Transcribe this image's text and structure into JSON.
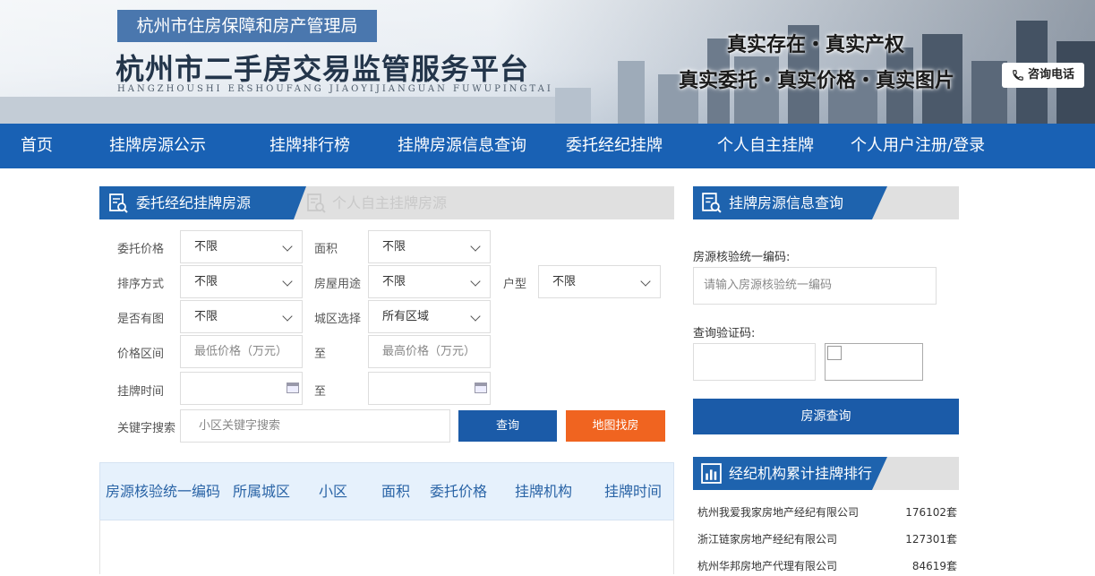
{
  "header": {
    "agency": "杭州市住房保障和房产管理局",
    "title": "杭州市二手房交易监管服务平台",
    "title_pinyin": "HANGZHOUSHI  ERSHOUFANG  JIAOYIJIANGUAN  FUWUPINGTAI",
    "slogan_line1": "真实存在・真实产权",
    "slogan_line2": "真实委托・真实价格・真实图片",
    "consult_label": "咨询电话"
  },
  "nav": [
    "首页",
    "挂牌房源公示",
    "挂牌排行榜",
    "挂牌房源信息查询",
    "委托经纪挂牌",
    "个人自主挂牌",
    "个人用户注册/登录"
  ],
  "tabs": {
    "active": "委托经纪挂牌房源",
    "inactive": "个人自主挂牌房源"
  },
  "filters": {
    "price_label": "委托价格",
    "price_value": "不限",
    "area_label": "面积",
    "area_value": "不限",
    "sort_label": "排序方式",
    "sort_value": "不限",
    "usage_label": "房屋用途",
    "usage_value": "不限",
    "type_label": "户型",
    "type_value": "不限",
    "photo_label": "是否有图",
    "photo_value": "不限",
    "district_label": "城区选择",
    "district_value": "所有区域",
    "range_label": "价格区间",
    "min_placeholder": "最低价格（万元）",
    "to1": "至",
    "max_placeholder": "最高价格（万元）",
    "time_label": "挂牌时间",
    "to2": "至",
    "keyword_label": "关键字搜索",
    "keyword_placeholder": "小区关键字搜索"
  },
  "buttons": {
    "search": "查询",
    "map": "地图找房"
  },
  "table": {
    "headers": [
      "房源核验统一编码",
      "所属城区",
      "小区",
      "面积",
      "委托价格",
      "挂牌机构",
      "挂牌时间"
    ]
  },
  "side": {
    "query_title": "挂牌房源信息查询",
    "code_label": "房源核验统一编码:",
    "code_placeholder": "请输入房源核验统一编码",
    "captcha_label": "查询验证码:",
    "query_button": "房源查询",
    "rank_title": "经纪机构累计挂牌排行榜",
    "ranks": [
      {
        "name": "杭州我爱我家房地产经纪有限公司",
        "count": "176102套"
      },
      {
        "name": "浙江链家房地产经纪有限公司",
        "count": "127301套"
      },
      {
        "name": "杭州华邦房地产代理有限公司",
        "count": "84619套"
      }
    ]
  },
  "colors": {
    "nav": "#1961b4",
    "accent": "#1e63ae",
    "orange": "#f06420",
    "table_head_bg": "#e6f1fc"
  }
}
